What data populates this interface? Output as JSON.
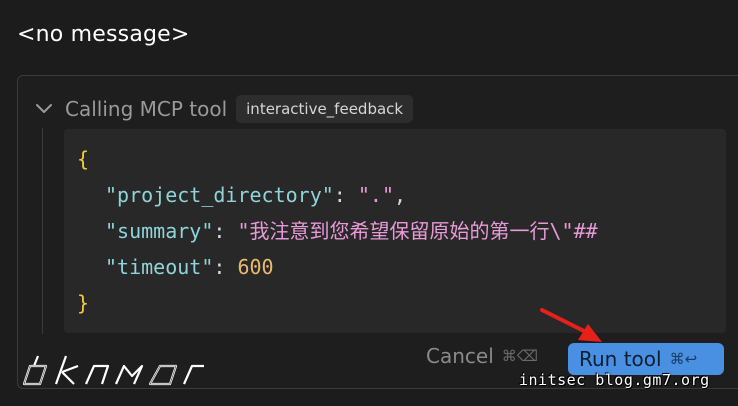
{
  "message": {
    "text": "<no message>"
  },
  "tool_call": {
    "title": "Calling MCP tool",
    "tool_name": "interactive_feedback",
    "code": {
      "open_brace": "{",
      "close_brace": "}",
      "params": [
        {
          "key": "\"project_directory\"",
          "separator": ": ",
          "value": "\".\"",
          "trailing": ","
        },
        {
          "key": "\"summary\"",
          "separator": ": ",
          "value": "\"我注意到您希望保留原始的第一行\\\"## ",
          "trailing": ""
        },
        {
          "key": "\"timeout\"",
          "separator": ": ",
          "value": "600",
          "trailing": ""
        }
      ]
    },
    "actions": {
      "cancel_label": "Cancel",
      "cancel_shortcut": "⌘⌫",
      "run_label": "Run tool",
      "run_shortcut": "⌘↩"
    }
  },
  "watermarks": {
    "left": "dKnMa",
    "right": "initsec blog.gm7.org"
  },
  "colors": {
    "background": "#1c1c1c",
    "code_background": "#282828",
    "accent": "#4a90e2",
    "annotation_arrow": "#e8201a",
    "json_brace": "#f2cc3d",
    "json_key": "#8fd4d9",
    "json_string": "#e89ad8",
    "json_number": "#e9b96e"
  }
}
